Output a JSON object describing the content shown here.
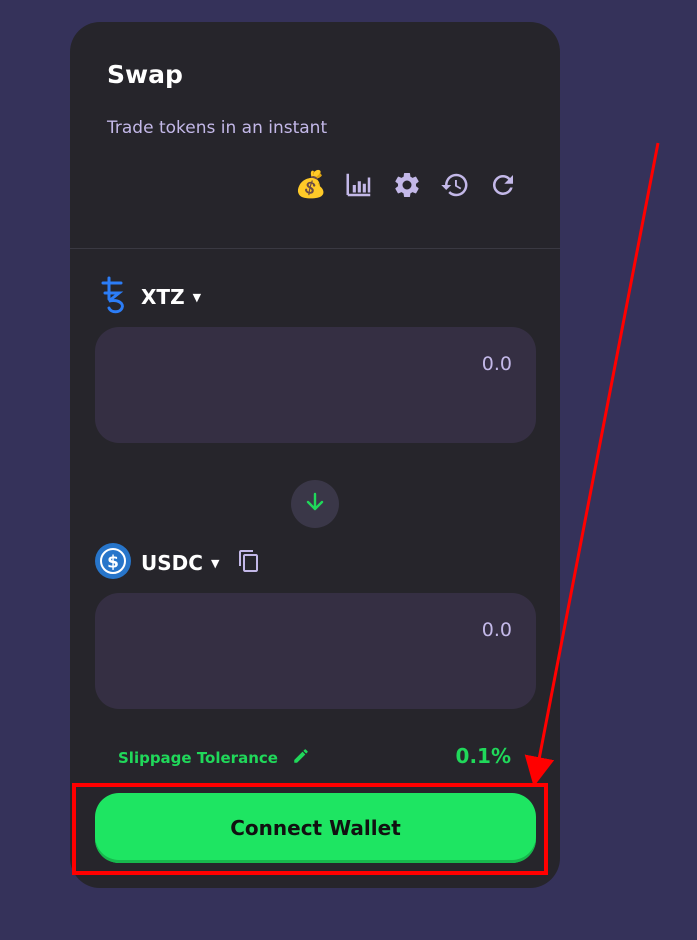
{
  "swap": {
    "title": "Swap",
    "subtitle": "Trade tokens in an instant"
  },
  "toolbar": {
    "icons": [
      "money-bag-icon",
      "chart-icon",
      "settings-gear-icon",
      "history-icon",
      "refresh-icon"
    ],
    "money_glyph": "💰"
  },
  "from_token": {
    "symbol": "XTZ",
    "caret": "▼",
    "icon": "tezos-icon",
    "amount_placeholder": "0.0"
  },
  "switch": {
    "icon": "arrow-down-icon"
  },
  "to_token": {
    "symbol": "USDC",
    "caret": "▼",
    "icon": "usdc-icon",
    "copy_icon": "copy-icon",
    "amount_placeholder": "0.0"
  },
  "slippage": {
    "label": "Slippage Tolerance",
    "value": "0.1%",
    "edit_icon": "pencil-icon"
  },
  "connect_button": {
    "label": "Connect Wallet"
  },
  "colors": {
    "background": "#35325a",
    "card": "#26252b",
    "input_box": "#352f43",
    "accent_green": "#1ee562",
    "muted_text": "#c3b8e8",
    "annotation_red": "#ff0000"
  }
}
